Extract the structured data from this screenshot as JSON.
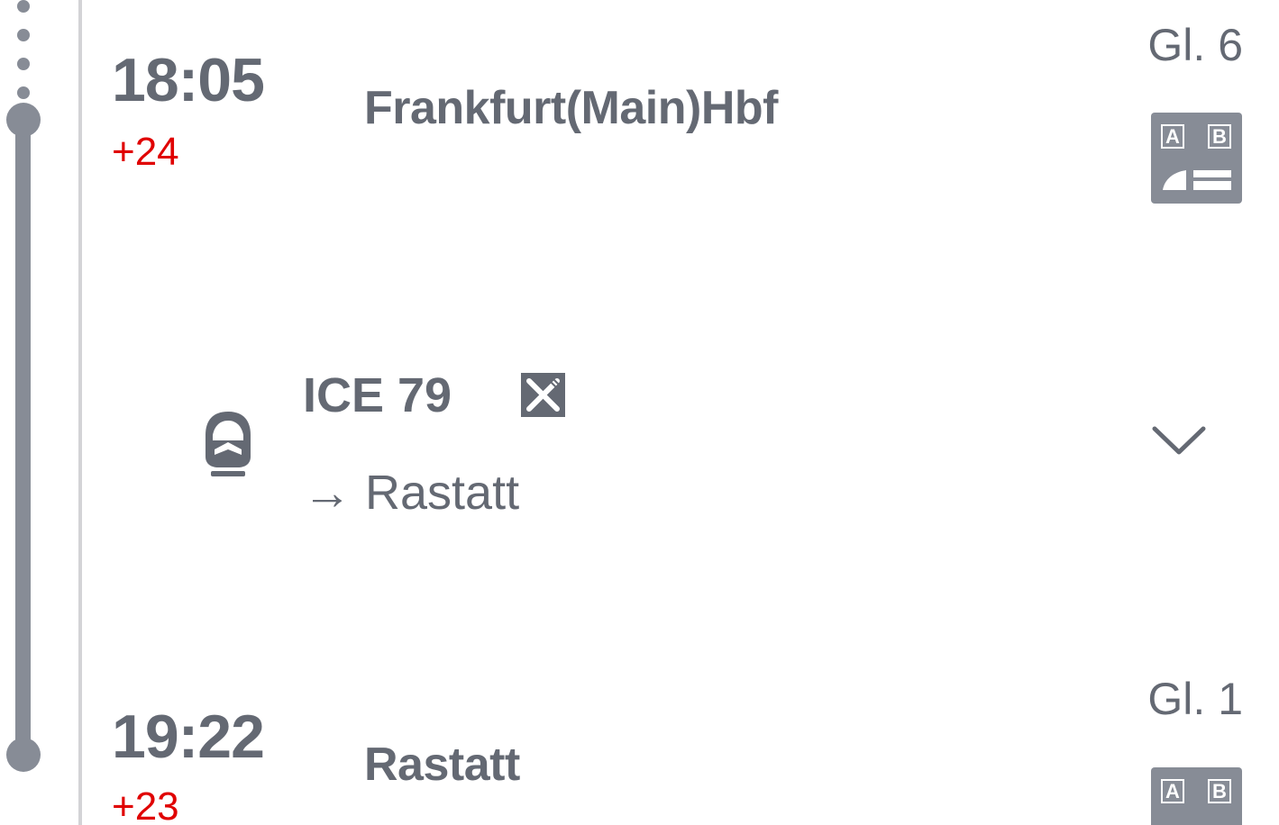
{
  "origin": {
    "time": "18:05",
    "delay": "+24",
    "station": "Frankfurt(Main)Hbf",
    "track": "Gl. 6",
    "platform_sector_icon": "platform-sector-ab-icon",
    "sector_labels": [
      "A",
      "B"
    ]
  },
  "train": {
    "name": "ICE 79",
    "direction": "→ Rastatt",
    "train_icon": "ice-train-icon",
    "amenity_icon": "bistro-restaurant-icon",
    "expand_icon": "chevron-down-icon"
  },
  "destination": {
    "time": "19:22",
    "delay": "+23",
    "station": "Rastatt",
    "track": "Gl. 1",
    "platform_sector_icon": "platform-sector-ab-icon",
    "sector_labels": [
      "A",
      "B"
    ]
  },
  "colors": {
    "text_gray": "#646973",
    "timeline_gray": "#878c96",
    "delay_red": "#e00000",
    "divider": "#d3d3d6"
  }
}
